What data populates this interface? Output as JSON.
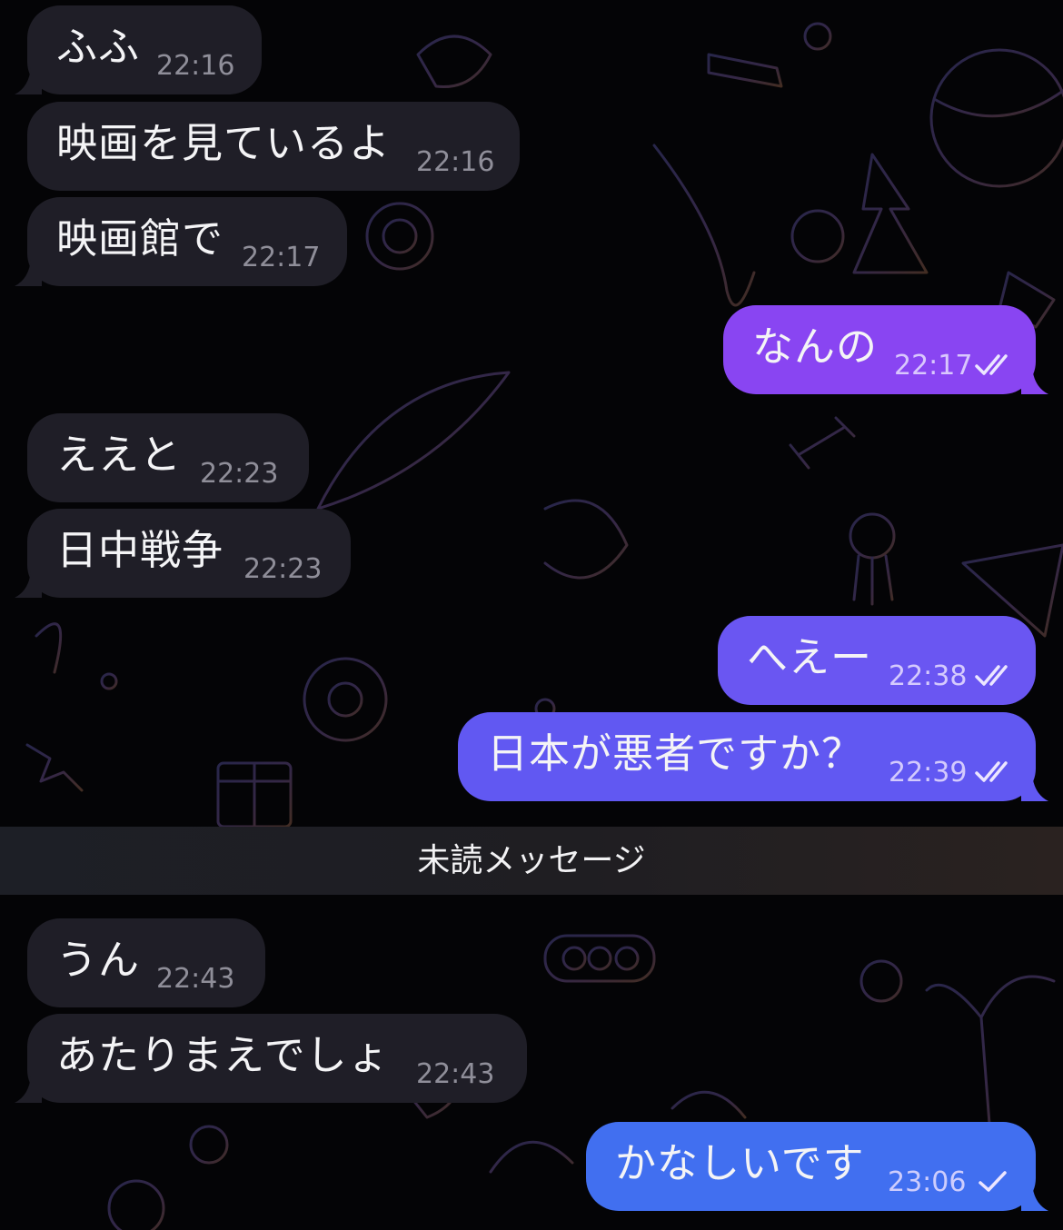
{
  "chat": {
    "unread_label": "未読メッセージ",
    "colors": {
      "incoming_bubble": "#1f1e27",
      "outgoing_gradient_top": "#8a47f2",
      "outgoing_gradient_bottom": "#3d6ff0",
      "timestamp": "#8f8e99"
    },
    "messages": [
      {
        "text": "ふふ",
        "time": "22:16",
        "direction": "in"
      },
      {
        "text": "映画を見ているよ",
        "time": "22:16",
        "direction": "in"
      },
      {
        "text": "映画館で",
        "time": "22:17",
        "direction": "in"
      },
      {
        "text": "なんの",
        "time": "22:17",
        "direction": "out",
        "status": "read"
      },
      {
        "text": "ええと",
        "time": "22:23",
        "direction": "in"
      },
      {
        "text": "日中戦争",
        "time": "22:23",
        "direction": "in"
      },
      {
        "text": "へえー",
        "time": "22:38",
        "direction": "out",
        "status": "read"
      },
      {
        "text": "日本が悪者ですか？",
        "time": "22:39",
        "direction": "out",
        "status": "read"
      },
      {
        "text": "うん",
        "time": "22:43",
        "direction": "in"
      },
      {
        "text": "あたりまえでしょ",
        "time": "22:43",
        "direction": "in"
      },
      {
        "text": "かなしいです",
        "time": "23:06",
        "direction": "out",
        "status": "sent"
      }
    ]
  }
}
